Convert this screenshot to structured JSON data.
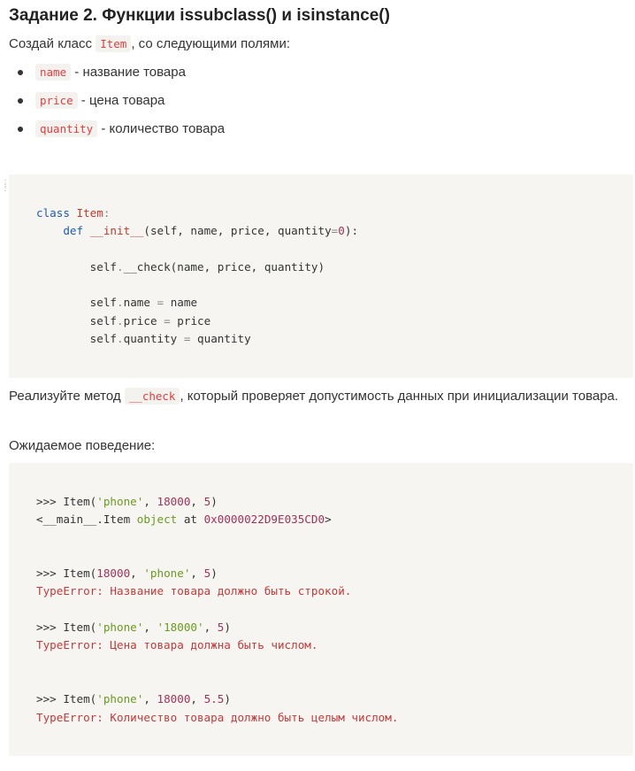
{
  "heading": "Задание 2. Функции issubclass() и isinstance()",
  "intro": {
    "before": "Создай класс ",
    "code": "Item",
    "after": ", со следующими полями:"
  },
  "fields": [
    {
      "code": "name",
      "text": " - название товара"
    },
    {
      "code": "price",
      "text": " - цена товара"
    },
    {
      "code": "quantity",
      "text": " - количество товара"
    }
  ],
  "code_block_1": {
    "l1": {
      "kw": "class",
      "name": "Item",
      "colon": ":"
    },
    "l2": {
      "kw": "def",
      "name": "__init__",
      "args": "(self, name, price, quantity",
      "eq": "=",
      "num": "0",
      "end": "):"
    },
    "l3": {
      "self": "self",
      "dot": ".",
      "call": "__check(name, price, quantity)"
    },
    "l4": {
      "self": "self",
      "dot": ".",
      "attr": "name",
      "eq": " = ",
      "val": "name"
    },
    "l5": {
      "self": "self",
      "dot": ".",
      "attr": "price",
      "eq": " = ",
      "val": "price"
    },
    "l6": {
      "self": "self",
      "dot": ".",
      "attr": "quantity",
      "eq": " = ",
      "val": "quantity"
    }
  },
  "task": {
    "before": "Реализуйте метод ",
    "code": "__check",
    "after": ", который проверяет допустимость данных при инициализации товара."
  },
  "expected": "Ожидаемое поведение:",
  "code_block_2": {
    "e1": {
      "prompt": ">>> Item(",
      "s1": "'phone'",
      "c1": ", ",
      "n1": "18000",
      "c2": ", ",
      "n2": "5",
      "end": ")"
    },
    "o1": {
      "a": "<__main__.Item ",
      "obj": "object",
      "at": " at ",
      "addr": "0x0000022D9E035CD0",
      "end": ">"
    },
    "e2": {
      "prompt": ">>> Item(",
      "n1": "18000",
      "c1": ", ",
      "s1": "'phone'",
      "c2": ", ",
      "n2": "5",
      "end": ")"
    },
    "o2": "TypeError: Название товара должно быть строкой.",
    "e3": {
      "prompt": ">>> Item(",
      "s1": "'phone'",
      "c1": ", ",
      "s2": "'18000'",
      "c2": ", ",
      "n2": "5",
      "end": ")"
    },
    "o3": "TypeError: Цена товара должна быть числом.",
    "e4": {
      "prompt": ">>> Item(",
      "s1": "'phone'",
      "c1": ", ",
      "n1": "18000",
      "c2": ", ",
      "n2": "5.5",
      "end": ")"
    },
    "o4": "TypeError: Количество товара должно быть целым числом."
  }
}
